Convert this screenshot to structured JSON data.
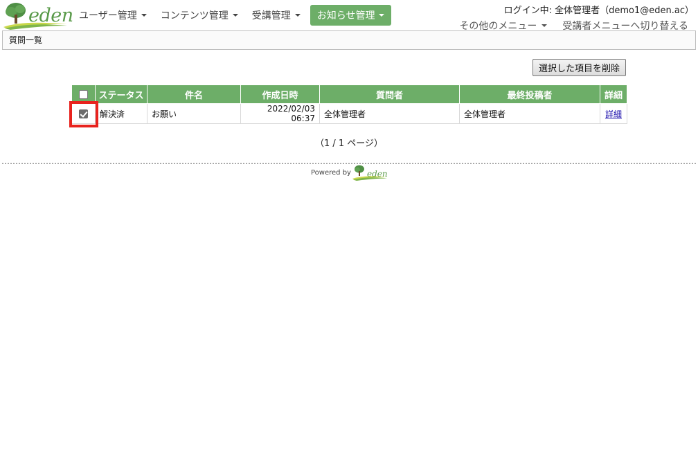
{
  "brand": {
    "logo_text": "eden",
    "accent_color": "#6dae68"
  },
  "nav": {
    "items": [
      {
        "label": "ユーザー管理",
        "active": false
      },
      {
        "label": "コンテンツ管理",
        "active": false
      },
      {
        "label": "受講管理",
        "active": false
      },
      {
        "label": "お知らせ管理",
        "active": true
      }
    ]
  },
  "user": {
    "login_text": "ログイン中: 全体管理者（demo1@eden.ac）"
  },
  "sub_nav": {
    "other_menu": "その他のメニュー",
    "switch_menu": "受講者メニューへ切り替える"
  },
  "breadcrumb": {
    "title": "質問一覧"
  },
  "toolbar": {
    "delete_label": "選択した項目を削除"
  },
  "table": {
    "headers": [
      "",
      "ステータス",
      "件名",
      "作成日時",
      "質問者",
      "最終投稿者",
      "詳細"
    ],
    "rows": [
      {
        "checked": true,
        "status": "解決済",
        "subject": "お願い",
        "created": "2022/02/03 06:37",
        "asker": "全体管理者",
        "last_poster": "全体管理者",
        "detail": "詳細"
      }
    ]
  },
  "pagination": {
    "text": "（1 / 1 ページ）"
  },
  "footer": {
    "powered_by": "Powered by",
    "logo_text": "eden"
  }
}
